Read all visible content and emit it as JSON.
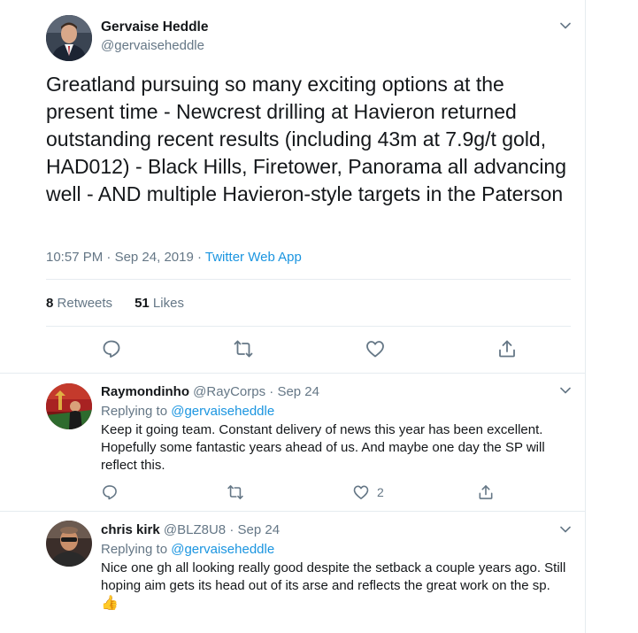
{
  "main_tweet": {
    "author_name": "Gervaise Heddle",
    "author_handle": "@gervaiseheddle",
    "text": "Greatland pursuing so many exciting options at the present time - Newcrest drilling at Havieron returned outstanding recent results (including 43m at 7.9g/t gold, HAD012) - Black Hills, Firetower, Panorama all advancing well - AND multiple Havieron-style targets in the Paterson",
    "time": "10:57 PM",
    "date": "Sep 24, 2019",
    "source": "Twitter Web App",
    "retweets_count": "8",
    "retweets_label": "Retweets",
    "likes_count": "51",
    "likes_label": "Likes",
    "icons": [
      "reply-icon",
      "retweet-icon",
      "like-icon",
      "share-icon"
    ]
  },
  "replies": [
    {
      "name": "Raymondinho",
      "handle": "@RayCorps",
      "date": "Sep 24",
      "replying_label": "Replying to",
      "replying_to": "@gervaiseheddle",
      "text": "Keep it going team. Constant delivery of news this year has been excellent. Hopefully some fantastic years ahead of us. And maybe one day the SP will reflect this.",
      "like_count": "2"
    },
    {
      "name": "chris kirk",
      "handle": "@BLZ8U8",
      "date": "Sep 24",
      "replying_label": "Replying to",
      "replying_to": "@gervaiseheddle",
      "text": "Nice one gh all looking really good despite the setback a couple years ago. Still hoping aim gets its head out of its arse and reflects the great work on the sp.",
      "emoji": "👍"
    }
  ],
  "separator": " · ",
  "colors": {
    "text": "#14171a",
    "secondary": "#657786",
    "link": "#1b95e0",
    "border": "#e6ecf0",
    "icon": "#657786"
  }
}
